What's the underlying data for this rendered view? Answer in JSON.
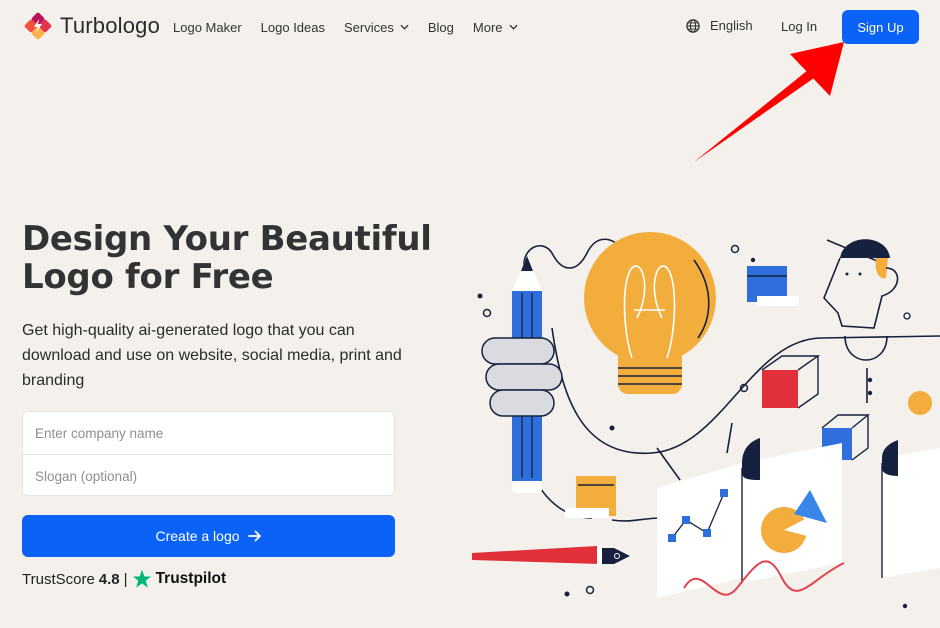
{
  "header": {
    "brand": "Turbologo",
    "nav": [
      {
        "label": "Logo Maker",
        "has_dropdown": false
      },
      {
        "label": "Logo Ideas",
        "has_dropdown": false
      },
      {
        "label": "Services",
        "has_dropdown": true
      },
      {
        "label": "Blog",
        "has_dropdown": false
      },
      {
        "label": "More",
        "has_dropdown": true
      }
    ],
    "language": "English",
    "login_label": "Log In",
    "signup_label": "Sign Up"
  },
  "hero": {
    "title": "Design Your Beautiful Logo for Free",
    "title_line1": "Design Your Beautiful",
    "title_line2": "Logo for Free",
    "subtitle": "Get high-quality ai-generated logo that you can download and use on website, social media, print and branding"
  },
  "form": {
    "company_placeholder": "Enter company name",
    "company_value": "",
    "slogan_placeholder": "Slogan (optional)",
    "slogan_value": "",
    "submit_label": "Create a logo"
  },
  "trust": {
    "label": "TrustScore",
    "score": "4.8",
    "separator": "|",
    "provider": "Trustpilot"
  },
  "icons": {
    "brand": "turbologo-logo-icon",
    "language": "globe-icon",
    "dropdown": "chevron-down-icon",
    "submit": "arrow-right-icon",
    "trust": "trustpilot-star-icon",
    "annotation": "red-arrow-annotation"
  },
  "colors": {
    "background": "#f4f1ec",
    "primary": "#0a63f6",
    "text": "#2b2b2b",
    "trustpilot_green": "#00b67a",
    "annotation_red": "#ff0000",
    "illustration_yellow": "#f2ad3c",
    "illustration_blue": "#2f6fdc",
    "illustration_red": "#e2303a",
    "illustration_navy": "#16213f"
  }
}
